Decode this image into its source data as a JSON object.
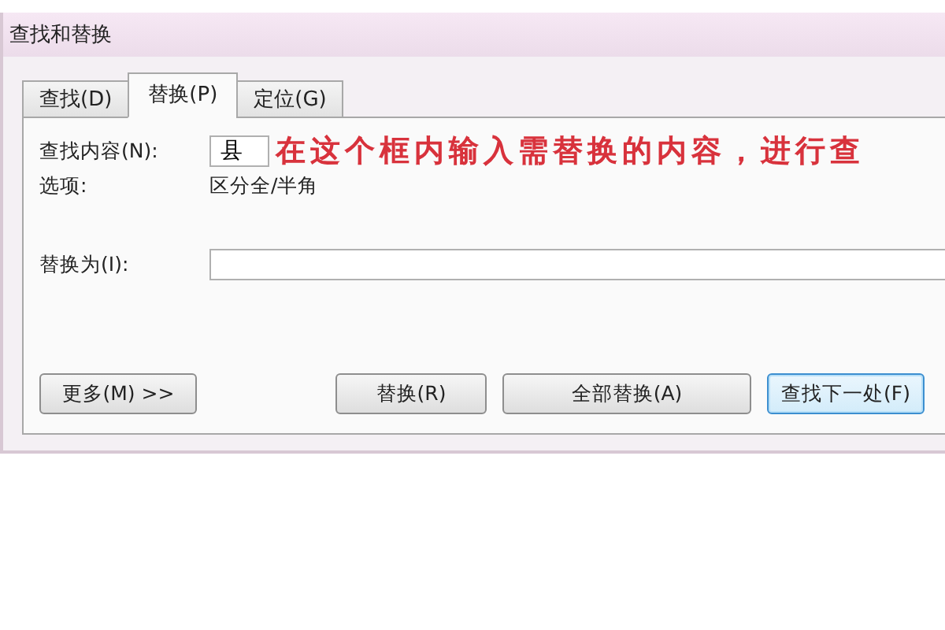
{
  "window": {
    "title": "查找和替换"
  },
  "tabs": [
    {
      "label": "查找(D)",
      "selected": false
    },
    {
      "label": "替换(P)",
      "selected": true
    },
    {
      "label": "定位(G)",
      "selected": false
    }
  ],
  "find": {
    "label": "查找内容(N):",
    "value": "县"
  },
  "annotation": "在这个框内输入需替换的内容，进行查",
  "options": {
    "label": "选项:",
    "value": "区分全/半角"
  },
  "replace": {
    "label": "替换为(I):"
  },
  "buttons": [
    {
      "label": "更多(M) >>",
      "kind": "more",
      "focused": false
    },
    {
      "label": "替换(R)",
      "kind": "action",
      "focused": false
    },
    {
      "label": "全部替换(A)",
      "kind": "action",
      "focused": false
    },
    {
      "label": "查找下一处(F)",
      "kind": "action",
      "focused": true
    }
  ]
}
